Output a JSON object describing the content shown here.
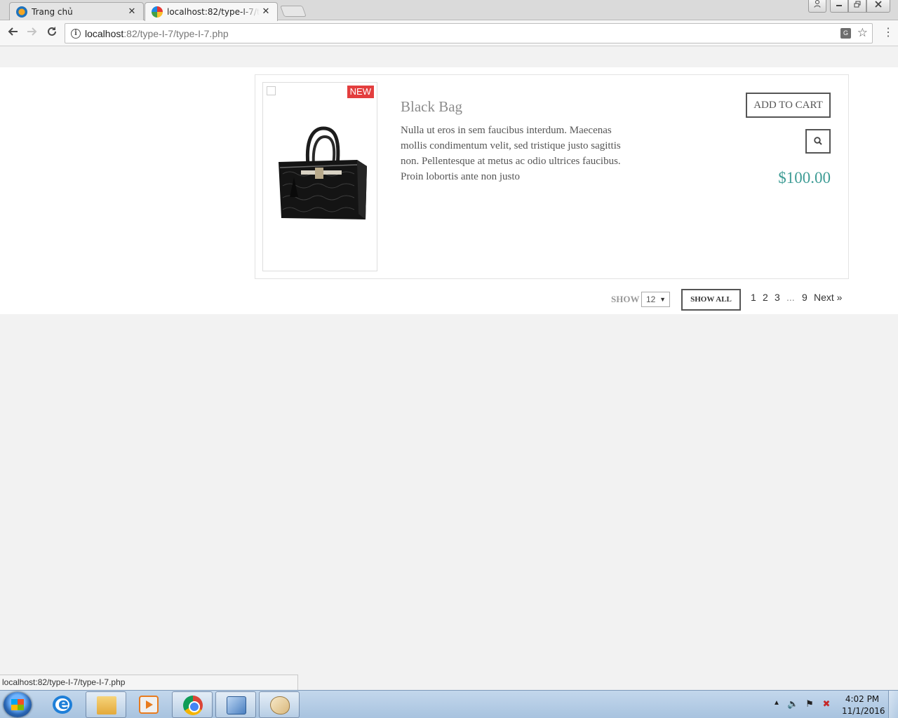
{
  "browser": {
    "tabs": [
      {
        "title": "Trang chủ",
        "active": false
      },
      {
        "title": "localhost:82/type-I-7/type-I-7.php",
        "active": true
      }
    ],
    "url": {
      "host": "localhost",
      "rest": ":82/type-I-7/type-I-7.php"
    },
    "status_url": "localhost:82/type-I-7/type-I-7.php",
    "close_glyph": "✕"
  },
  "product": {
    "badge": "NEW",
    "title": "Black Bag",
    "description": "Nulla ut eros in sem faucibus interdum. Maecenas mollis condimentum velit, sed tristique justo sagittis non. Pellentesque at metus ac odio ultrices faucibus. Proin lobortis ante non justo",
    "add_to_cart": "ADD TO CART",
    "price": "$100.00",
    "price_color": "#3e9c95",
    "badge_color": "#e33e3e"
  },
  "pagination": {
    "show_label": "SHOW",
    "per_page": "12",
    "show_all": "SHOW ALL",
    "pages": [
      "1",
      "2",
      "3",
      "...",
      "9"
    ],
    "next": "Next »"
  },
  "taskbar": {
    "items": [
      "start-icon",
      "internet-explorer-icon",
      "file-explorer-icon",
      "media-player-icon",
      "chrome-icon",
      "virtualbox-icon",
      "paint-icon"
    ],
    "time": "4:02 PM",
    "date": "11/1/2016"
  }
}
